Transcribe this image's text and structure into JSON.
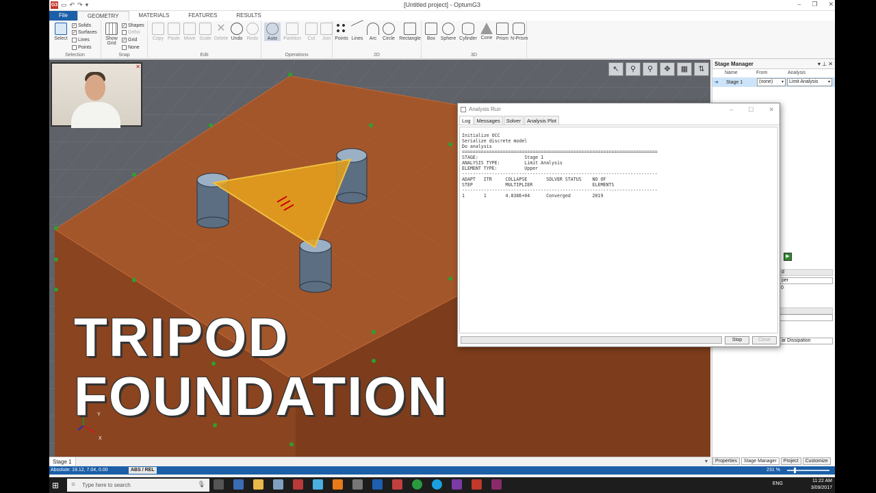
{
  "window": {
    "title": "[Untitled project] - OptumG3"
  },
  "ribbon_tabs": [
    {
      "label": "File"
    },
    {
      "label": "GEOMETRY"
    },
    {
      "label": "MATERIALS"
    },
    {
      "label": "FEATURES"
    },
    {
      "label": "RESULTS"
    }
  ],
  "ribbon": {
    "selection": {
      "label": "Selection",
      "select": "Select",
      "solids": "Solids",
      "surfaces": "Surfaces",
      "lines": "Lines",
      "points": "Points"
    },
    "snap": {
      "label": "Snap",
      "show_grid": "Show",
      "show_grid2": "Grid",
      "shapes": "Shapes",
      "ortho": "Ortho",
      "grid": "Grid",
      "none": "None"
    },
    "edit": {
      "label": "Edit",
      "copy": "Copy",
      "paste": "Paste",
      "move": "Move",
      "scale": "Scale",
      "delete": "Delete",
      "undo": "Undo",
      "redo": "Redo"
    },
    "operations": {
      "label": "Operations",
      "auto": "Auto",
      "partition": "Partition",
      "cut": "Cut",
      "join": "Join"
    },
    "two_d": {
      "label": "2D",
      "points": "Points",
      "lines": "Lines",
      "arc": "Arc",
      "circle": "Circle",
      "rectangle": "Rectangle"
    },
    "three_d": {
      "label": "3D",
      "box": "Box",
      "sphere": "Sphere",
      "cylinder": "Cylinder",
      "cone": "Cone",
      "prism": "Prism",
      "nprism": "N-Prism"
    }
  },
  "overlay": {
    "line1": "TRIPOD",
    "line2": "FOUNDATION"
  },
  "triad": {
    "y": "Y",
    "x": "X"
  },
  "stage_tab": "Stage 1",
  "status": {
    "coords": "Absolute: 19.12, 7.04, 0.00",
    "absrel": "ABS / REL",
    "zoom": "231 %"
  },
  "stage_manager": {
    "title": "Stage Manager",
    "columns": [
      "Name",
      "From",
      "Analysis"
    ],
    "row": {
      "name": "Stage 1",
      "from": "(none)",
      "analysis": "Limit Analysis"
    },
    "partial_fields": [
      "d",
      "per",
      "0",
      "ar Dissipation"
    ]
  },
  "right_tabs": [
    "Properties",
    "Stage Manager",
    "Project",
    "Customize"
  ],
  "dialog": {
    "title": "Analysis Run",
    "tabs": [
      "Log",
      "Messages",
      "Solver",
      "Analysis Plot"
    ],
    "log": "Initialize OCC\nSerialize discrete model\nDo analysis\n========================================================================\nSTAGE:                 Stage 1\nANALYSIS TYPE:         Limit Analysis\nELEMENT TYPE:          Upper\n------------------------------------------------------------------------\nADAPT   ITR     COLLAPSE       SOLVER STATUS    NO OF\nSTEP            MULTIPLIER                      ELEMENTS\n------------------------------------------------------------------------\n1       1       4.838E+04      Converged        2019",
    "stop": "Stop",
    "close": "Close"
  },
  "taskbar": {
    "search_placeholder": "Type here to search",
    "lang": "ENG",
    "time": "11:22 AM",
    "date": "3/09/2017"
  }
}
